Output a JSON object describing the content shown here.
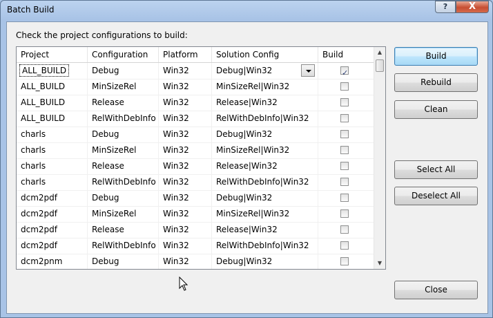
{
  "window": {
    "title": "Batch Build",
    "help_glyph": "?",
    "close_glyph": "X"
  },
  "instruction": "Check the project configurations to build:",
  "table": {
    "columns": [
      "Project",
      "Configuration",
      "Platform",
      "Solution Config",
      "Build"
    ],
    "rows": [
      {
        "project": "ALL_BUILD",
        "config": "Debug",
        "platform": "Win32",
        "solution": "Debug|Win32",
        "build": true
      },
      {
        "project": "ALL_BUILD",
        "config": "MinSizeRel",
        "platform": "Win32",
        "solution": "MinSizeRel|Win32",
        "build": false
      },
      {
        "project": "ALL_BUILD",
        "config": "Release",
        "platform": "Win32",
        "solution": "Release|Win32",
        "build": false
      },
      {
        "project": "ALL_BUILD",
        "config": "RelWithDebInfo",
        "platform": "Win32",
        "solution": "RelWithDebInfo|Win32",
        "build": false
      },
      {
        "project": "charls",
        "config": "Debug",
        "platform": "Win32",
        "solution": "Debug|Win32",
        "build": false
      },
      {
        "project": "charls",
        "config": "MinSizeRel",
        "platform": "Win32",
        "solution": "MinSizeRel|Win32",
        "build": false
      },
      {
        "project": "charls",
        "config": "Release",
        "platform": "Win32",
        "solution": "Release|Win32",
        "build": false
      },
      {
        "project": "charls",
        "config": "RelWithDebInfo",
        "platform": "Win32",
        "solution": "RelWithDebInfo|Win32",
        "build": false
      },
      {
        "project": "dcm2pdf",
        "config": "Debug",
        "platform": "Win32",
        "solution": "Debug|Win32",
        "build": false
      },
      {
        "project": "dcm2pdf",
        "config": "MinSizeRel",
        "platform": "Win32",
        "solution": "MinSizeRel|Win32",
        "build": false
      },
      {
        "project": "dcm2pdf",
        "config": "Release",
        "platform": "Win32",
        "solution": "Release|Win32",
        "build": false
      },
      {
        "project": "dcm2pdf",
        "config": "RelWithDebInfo",
        "platform": "Win32",
        "solution": "RelWithDebInfo|Win32",
        "build": false
      },
      {
        "project": "dcm2pnm",
        "config": "Debug",
        "platform": "Win32",
        "solution": "Debug|Win32",
        "build": false
      }
    ]
  },
  "buttons": {
    "build": "Build",
    "rebuild": "Rebuild",
    "clean": "Clean",
    "select_all": "Select All",
    "deselect_all": "Deselect All",
    "close": "Close"
  },
  "icons": {
    "dropdown": "chevron-down-icon",
    "scroll_up": "scroll-up-arrow",
    "scroll_down": "scroll-down-arrow",
    "cursor": "mouse-pointer-icon"
  }
}
